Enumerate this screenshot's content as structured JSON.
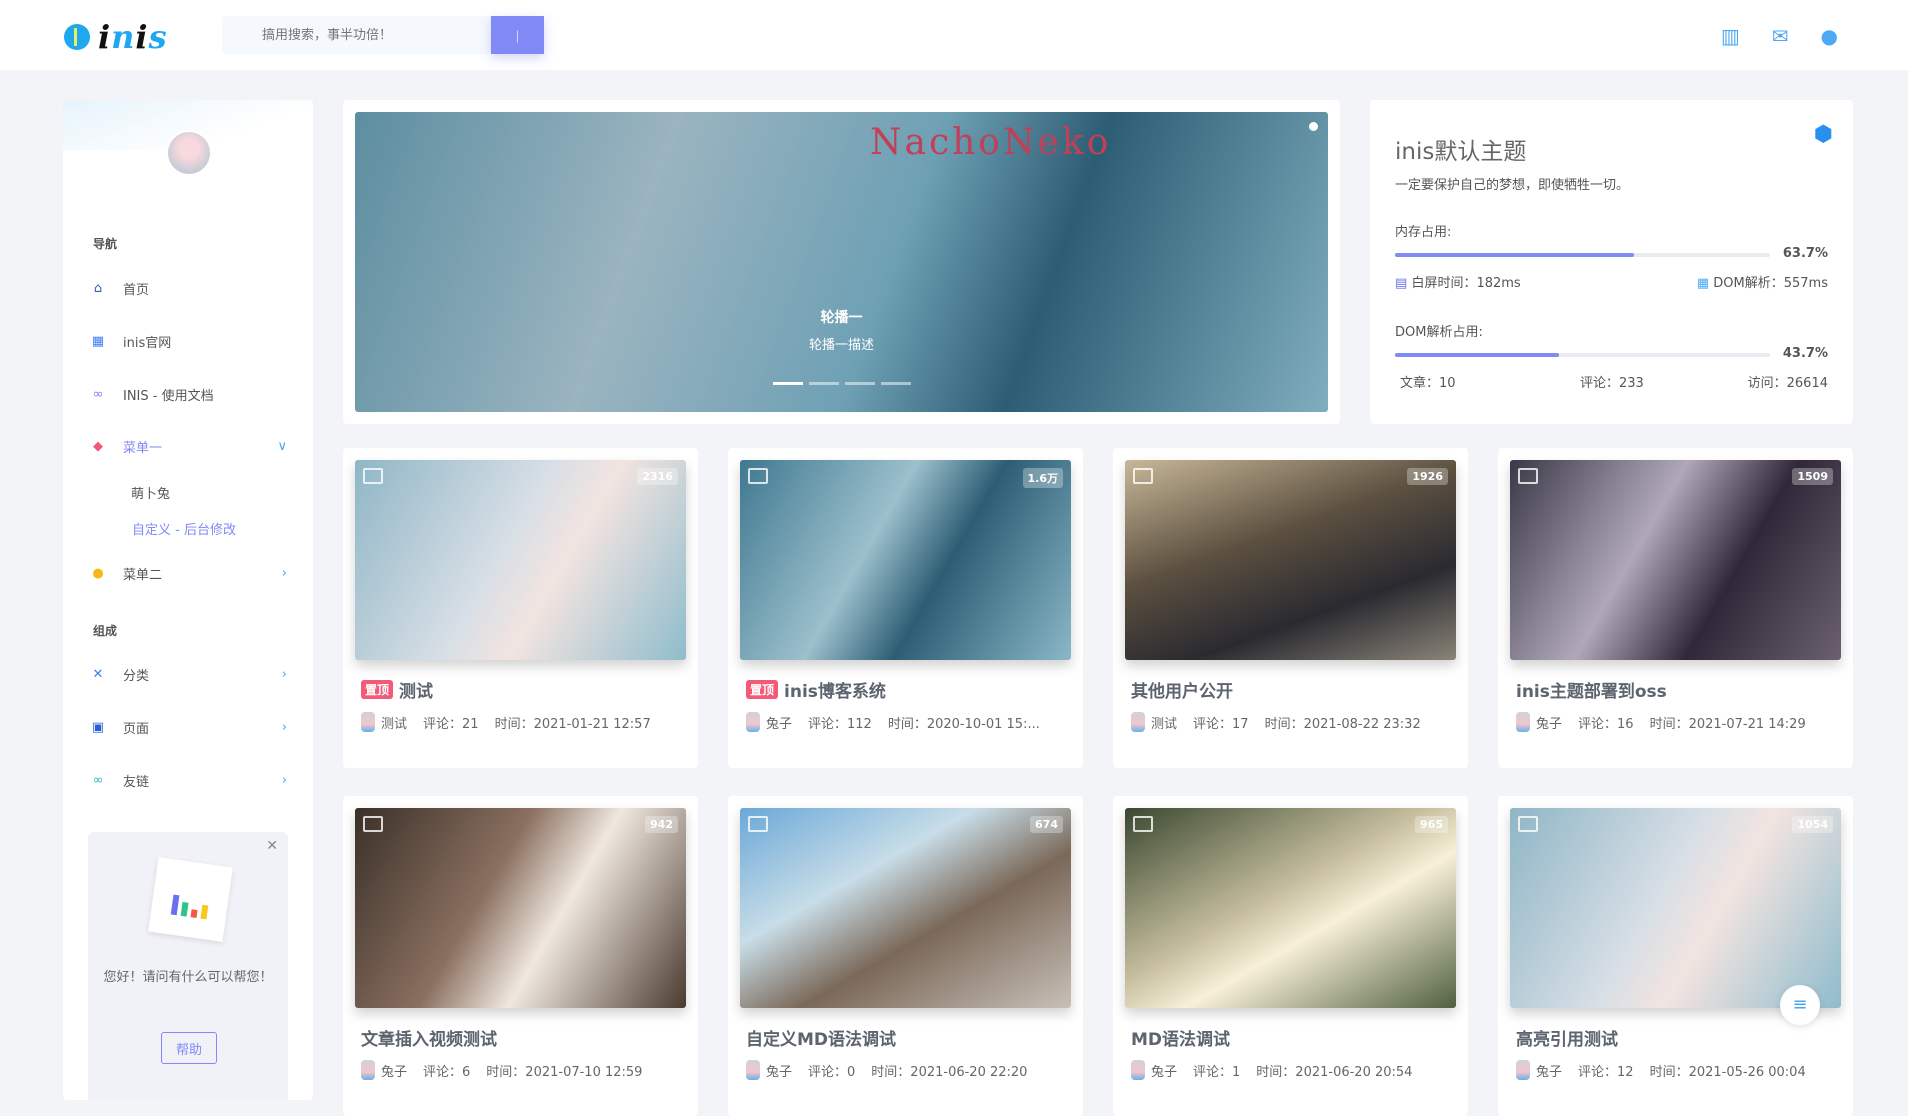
{
  "header": {
    "logo": "inis",
    "search_placeholder": "搞用搜索，事半功倍！",
    "icons": [
      "stats-icon",
      "mail-icon",
      "user-icon"
    ]
  },
  "sidebar": {
    "section_nav": "导航",
    "items": [
      {
        "label": "首页",
        "icon": "home-icon"
      },
      {
        "label": "inis官网",
        "icon": "grid-icon"
      },
      {
        "label": "INIS - 使用文档",
        "icon": "bike-icon"
      },
      {
        "label": "菜单一",
        "icon": "tag-icon",
        "expanded": true
      },
      {
        "label": "菜单二",
        "icon": "chat-icon"
      }
    ],
    "submenu": [
      "萌卜兔",
      "自定义 - 后台修改"
    ],
    "section_compose": "组成",
    "compose_items": [
      {
        "label": "分类",
        "icon": "category-icon"
      },
      {
        "label": "页面",
        "icon": "page-icon"
      },
      {
        "label": "友链",
        "icon": "link-icon"
      }
    ],
    "help": {
      "text": "您好！请问有什么可以帮您！",
      "button": "帮助"
    }
  },
  "carousel": {
    "sign": "NachoNeko",
    "title": "轮播一",
    "desc": "轮播一描述",
    "slides": 4,
    "active": 0
  },
  "info": {
    "title": "inis默认主题",
    "desc": "一定要保护自己的梦想，即使牺牲一切。",
    "mem_label": "内存占用:",
    "mem_pct": "63.7%",
    "mem_value": 63.7,
    "white_screen": "白屏时间：182ms",
    "dom_parse": "DOM解析：557ms",
    "dom_label": "DOM解析占用:",
    "dom_pct": "43.7%",
    "dom_value": 43.7,
    "articles": "文章：10",
    "comments": "评论：233",
    "visits": "访问：26614"
  },
  "posts": [
    {
      "title": "测试",
      "top": "置顶",
      "author": "测试",
      "comments": "评论：21",
      "time": "时间：2021-01-21 12:57",
      "views": "2316"
    },
    {
      "title": "inis博客系统",
      "top": "置顶",
      "author": "兔子",
      "comments": "评论：112",
      "time": "时间：2020-10-01 15:...",
      "views": "1.6万"
    },
    {
      "title": "其他用户公开",
      "author": "测试",
      "comments": "评论：17",
      "time": "时间：2021-08-22 23:32",
      "views": "1926"
    },
    {
      "title": "inis主题部署到oss",
      "author": "兔子",
      "comments": "评论：16",
      "time": "时间：2021-07-21 14:29",
      "views": "1509"
    },
    {
      "title": "文章插入视频测试",
      "author": "兔子",
      "comments": "评论：6",
      "time": "时间：2021-07-10 12:59",
      "views": "942"
    },
    {
      "title": "自定义MD语法调试",
      "author": "兔子",
      "comments": "评论：0",
      "time": "时间：2021-06-20 22:20",
      "views": "674"
    },
    {
      "title": "MD语法调试",
      "author": "兔子",
      "comments": "评论：1",
      "time": "时间：2021-06-20 20:54",
      "views": "965"
    },
    {
      "title": "高亮引用测试",
      "author": "兔子",
      "comments": "评论：12",
      "time": "时间：2021-05-26 00:04",
      "views": "1054"
    }
  ],
  "colors": {
    "accent": "#8189f5",
    "top_badge": "#f35a78",
    "icon_blue": "#48a6f2"
  }
}
